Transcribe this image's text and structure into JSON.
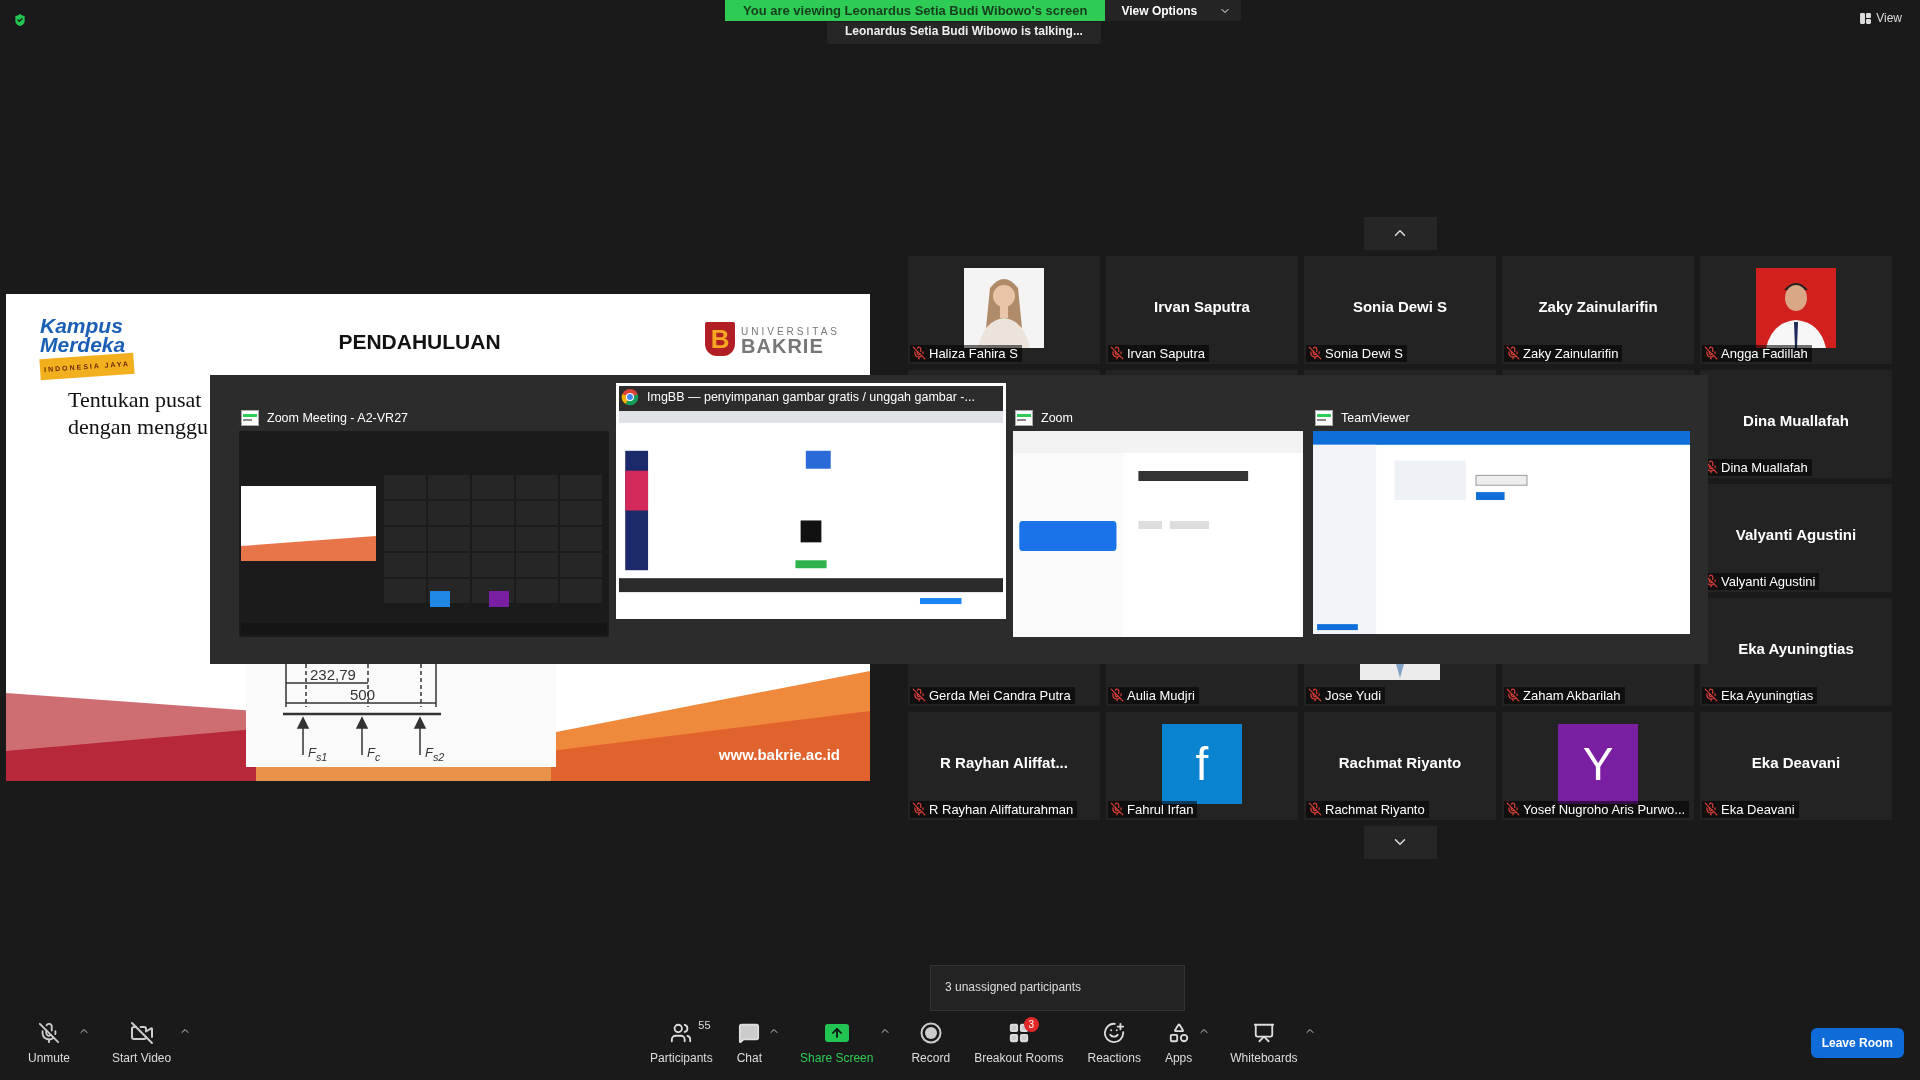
{
  "top_bar": {
    "banner": "You are viewing Leonardus Setia Budi Wibowo's screen",
    "view_options": "View Options",
    "speaker": "Leonardus Setia Budi Wibowo is talking...",
    "view_button": "View"
  },
  "slide": {
    "logo_left": {
      "line_1": "Kampus",
      "line_2": "Merdeka",
      "tagline": "INDONESIA JAYA"
    },
    "title": "PENDAHULUAN",
    "logo_right": {
      "mark": "B",
      "line_1": "UNIVERSITAS",
      "line_2": "BAKRIE"
    },
    "text_lines": [
      "Tentukan pusat",
      "dengan menggu"
    ],
    "diagram_labels": [
      "232,79",
      "500",
      "F$_{s1}$",
      "F$_{c}$",
      "F$_{s2}$"
    ],
    "footer": "www.bakrie.ac.id"
  },
  "share_picker": {
    "windows": [
      {
        "title": "Zoom Meeting - A2-VR27",
        "kind": "app",
        "selected": false
      },
      {
        "title": "ImgBB — penyimpanan gambar gratis / unggah gambar -...",
        "kind": "browser",
        "selected": true
      },
      {
        "title": "Zoom",
        "kind": "app",
        "selected": false
      },
      {
        "title": "TeamViewer",
        "kind": "app",
        "selected": false
      }
    ]
  },
  "gallery": {
    "tiles": [
      {
        "label": "Haliza Fahira S",
        "muted": true
      },
      {
        "kind": "name",
        "display": "Irvan Saputra",
        "label": "Irvan Saputra",
        "muted": true
      },
      {
        "kind": "name",
        "display": "Sonia Dewi S",
        "label": "Sonia Dewi S",
        "muted": true
      },
      {
        "kind": "name",
        "display": "Zaky Zainularifin",
        "label": "Zaky Zainularifin",
        "muted": true
      },
      {
        "label": "Angga Fadillah",
        "muted": true
      },
      {
        "kind": "hidden"
      },
      {
        "kind": "hidden"
      },
      {
        "kind": "hidden"
      },
      {
        "kind": "hidden"
      },
      {
        "kind": "name",
        "display": "Dina Muallafah",
        "label": "Dina Muallafah",
        "muted": true
      },
      {
        "kind": "covered"
      },
      {
        "kind": "covered"
      },
      {
        "kind": "covered"
      },
      {
        "kind": "covered"
      },
      {
        "kind": "name",
        "display": "Valyanti Agustini",
        "label": "Valyanti Agustini",
        "muted": true
      },
      {
        "kind": "hidden",
        "label": "Gerda Mei Candra Putra",
        "muted": true
      },
      {
        "kind": "hidden",
        "label": "Aulia Mudjri",
        "muted": true
      },
      {
        "label": "Jose Yudi",
        "muted": true
      },
      {
        "kind": "hidden",
        "label": "Zaham Akbarilah",
        "muted": true
      },
      {
        "kind": "name",
        "display": "Eka Ayuningtias",
        "label": "Eka Ayuningtias",
        "muted": true
      },
      {
        "kind": "name",
        "display": "R Rayhan Aliffat...",
        "label": "R Rayhan Aliffaturahman",
        "muted": true
      },
      {
        "kind": "avatar",
        "letter": "f",
        "color": "#0a84d0",
        "label": "Fahrul Irfan",
        "muted": true
      },
      {
        "kind": "name",
        "display": "Rachmat Riyanto",
        "label": "Rachmat Riyanto",
        "muted": true
      },
      {
        "kind": "avatar",
        "letter": "Y",
        "color": "#7b1fa2",
        "label": "Yosef Nugroho Aris Purwo...",
        "muted": true
      },
      {
        "kind": "name",
        "display": "Eka Deavani",
        "label": "Eka Deavani",
        "muted": true
      }
    ]
  },
  "tooltip": "3 unassigned participants",
  "toolbar": {
    "items": [
      {
        "kind": "mute",
        "label": "Unmute",
        "caret": true
      },
      {
        "kind": "video",
        "label": "Start Video",
        "caret": true
      },
      {
        "kind": "participants",
        "label": "Participants",
        "count": "55",
        "caret": false
      },
      {
        "kind": "chat",
        "label": "Chat",
        "caret": true
      },
      {
        "kind": "share",
        "label": "Share Screen",
        "caret": true
      },
      {
        "kind": "record",
        "label": "Record",
        "caret": false
      },
      {
        "kind": "breakout",
        "label": "Breakout Rooms",
        "badge": "3",
        "caret": false
      },
      {
        "kind": "reactions",
        "label": "Reactions",
        "caret": false
      },
      {
        "kind": "apps",
        "label": "Apps",
        "caret": true
      },
      {
        "kind": "whiteboards",
        "label": "Whiteboards",
        "caret": true
      }
    ],
    "leave": "Leave Room"
  }
}
